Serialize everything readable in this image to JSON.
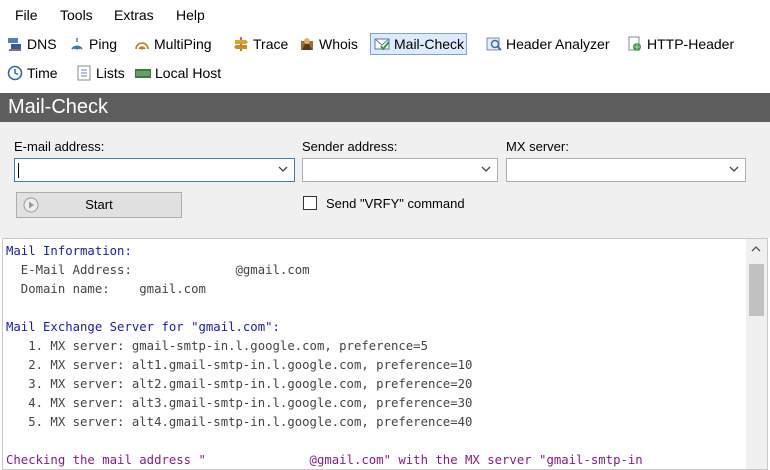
{
  "menu": [
    "File",
    "Tools",
    "Extras",
    "Help"
  ],
  "toolbar_row1": [
    {
      "label": "DNS",
      "icon": "dns-icon"
    },
    {
      "label": "Ping",
      "icon": "ping-icon"
    },
    {
      "label": "MultiPing",
      "icon": "multiping-icon"
    },
    {
      "label": "Trace",
      "icon": "trace-icon"
    },
    {
      "label": "Whois",
      "icon": "whois-icon"
    },
    {
      "label": "Mail-Check",
      "icon": "mail-check-icon",
      "active": true
    },
    {
      "label": "Header Analyzer",
      "icon": "header-analyzer-icon"
    },
    {
      "label": "HTTP-Header",
      "icon": "http-header-icon"
    }
  ],
  "toolbar_row2": [
    {
      "label": "Time",
      "icon": "clock-icon"
    },
    {
      "label": "Lists",
      "icon": "lists-icon"
    },
    {
      "label": "Local Host",
      "icon": "local-host-icon"
    }
  ],
  "panel": {
    "title": "Mail-Check"
  },
  "form": {
    "email_label": "E-mail address:",
    "email_value": "",
    "sender_label": "Sender address:",
    "sender_value": "",
    "mx_label": "MX server:",
    "mx_value": "",
    "start_label": "Start",
    "vrfy_label": "Send \"VRFY\" command",
    "vrfy_checked": false
  },
  "output": {
    "lines": [
      {
        "text": "Mail Information:",
        "color": "#1a1ab8"
      },
      {
        "text": "  E-Mail Address:              @gmail.com",
        "color": "#444444"
      },
      {
        "text": "  Domain name:    gmail.com",
        "color": "#444444"
      },
      {
        "text": "",
        "color": "#444444"
      },
      {
        "text": "Mail Exchange Server for \"gmail.com\":",
        "color": "#1a1ab8"
      },
      {
        "text": "   1. MX server: gmail-smtp-in.l.google.com, preference=5",
        "color": "#444444"
      },
      {
        "text": "   2. MX server: alt1.gmail-smtp-in.l.google.com, preference=10",
        "color": "#444444"
      },
      {
        "text": "   3. MX server: alt2.gmail-smtp-in.l.google.com, preference=20",
        "color": "#444444"
      },
      {
        "text": "   4. MX server: alt3.gmail-smtp-in.l.google.com, preference=30",
        "color": "#444444"
      },
      {
        "text": "   5. MX server: alt4.gmail-smtp-in.l.google.com, preference=40",
        "color": "#444444"
      },
      {
        "text": "",
        "color": "#444444"
      },
      {
        "text": "Checking the mail address \"              @gmail.com\" with the MX server \"gmail-smtp-in",
        "color": "#8a1a8a"
      }
    ]
  },
  "colors": {
    "panel_title_bg": "#5d5d5d",
    "form_bg": "#f0f0f0",
    "active_tool_bg": "#dcebfb",
    "heading_text": "#1a1ab8",
    "check_text": "#8a1a8a"
  }
}
